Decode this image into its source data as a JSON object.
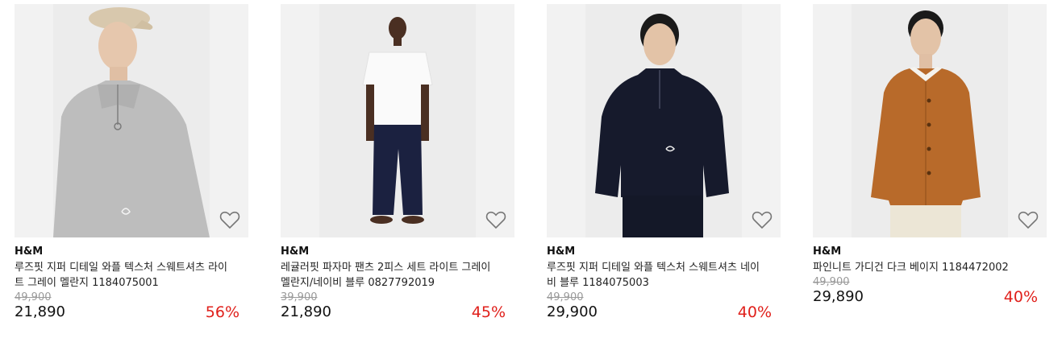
{
  "products": [
    {
      "brand": "H&M",
      "name": "루즈핏 지퍼 디테일 와플 텍스처 스웨트셔츠 라이트 그레이 멜란지 1184075001",
      "original_price": "49,900",
      "price": "21,890",
      "discount": "56%",
      "garment_color": "#bdbdbd"
    },
    {
      "brand": "H&M",
      "name": "레귤러핏 파자마 팬츠 2피스 세트 라이트 그레이 멜란지/네이비 블루 0827792019",
      "original_price": "39,900",
      "price": "21,890",
      "discount": "45%",
      "garment_color": "#1b2140"
    },
    {
      "brand": "H&M",
      "name": "루즈핏 지퍼 디테일 와플 텍스처 스웨트셔츠 네이비 블루 1184075003",
      "original_price": "49,900",
      "price": "29,900",
      "discount": "40%",
      "garment_color": "#161a2c"
    },
    {
      "brand": "H&M",
      "name": "파인니트 가디건 다크 베이지 1184472002",
      "original_price": "49,900",
      "price": "29,890",
      "discount": "40%",
      "garment_color": "#b86a2a"
    }
  ],
  "colors": {
    "discount": "#e0201b",
    "strikethrough": "#9a9a9a",
    "image_bg": "#f2f2f2"
  },
  "icons": {
    "wishlist": "heart-outline-icon"
  }
}
